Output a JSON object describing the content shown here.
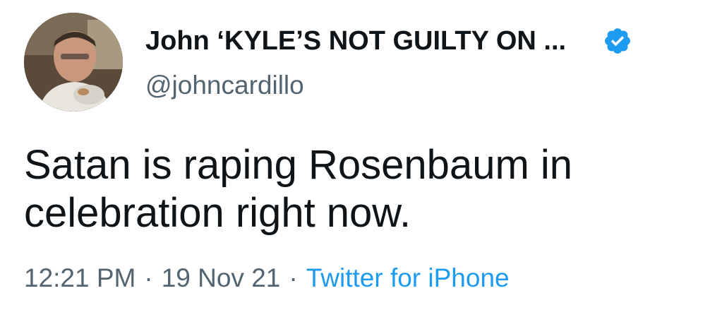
{
  "author": {
    "display_name": "John ‘KYLE’S NOT GUILTY ON ...",
    "handle": "@johncardillo",
    "avatar_icon": "profile-photo",
    "verified_icon": "verified-badge-icon",
    "verified_color": "#1d9bf0"
  },
  "tweet": {
    "text": "Satan is raping Rosenbaum in celebration right now."
  },
  "meta": {
    "time": "12:21 PM",
    "separator": "·",
    "date": "19 Nov 21",
    "source": "Twitter for iPhone",
    "source_color": "#1d9bf0"
  }
}
